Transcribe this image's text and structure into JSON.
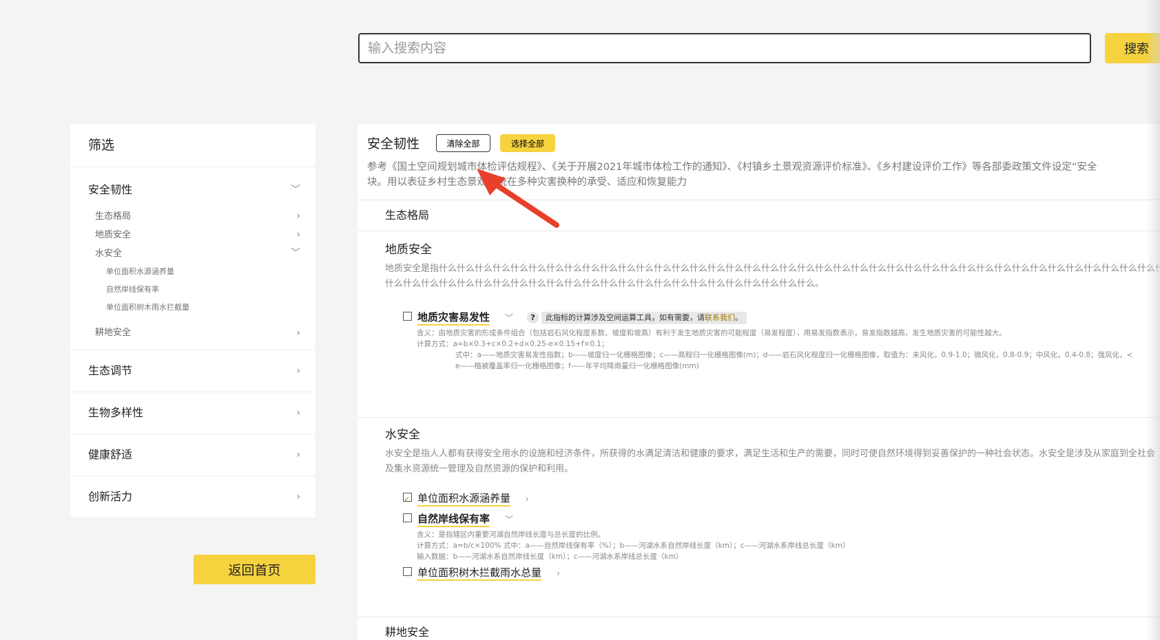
{
  "search": {
    "placeholder": "输入搜索内容",
    "button": "搜索"
  },
  "sidebar": {
    "title": "筛选",
    "groups": [
      {
        "label": "安全韧性",
        "expanded": true,
        "subs": [
          {
            "label": "生态格局"
          },
          {
            "label": "地质安全"
          },
          {
            "label": "水安全",
            "expanded": true,
            "children": [
              "单位面积水源涵养量",
              "自然岸线保有率",
              "单位面积树木雨水拦截量"
            ]
          },
          {
            "label": "耕地安全"
          }
        ]
      },
      {
        "label": "生态调节"
      },
      {
        "label": "生物多样性"
      },
      {
        "label": "健康舒适"
      },
      {
        "label": "创新活力"
      }
    ],
    "back_button": "返回首页"
  },
  "main": {
    "title": "安全韧性",
    "clear_all": "清除全部",
    "select_all": "选择全部",
    "desc_line1": "参考《国土空间规划城市体检评估规程》、《关于开展2021年城市体检工作的通知》、《村镇乡土景观资源评价标准》、《乡村建设评价工作》等各部委政策文件设定“安全",
    "desc_line2": "块。用以表征乡村生态景观系统在多种灾害换种的承受、适应和恢复能力",
    "eco": {
      "title": "生态格局"
    },
    "geo": {
      "title": "地质安全",
      "desc_line1": "地质安全是指什么什么什么什么什么什么什么什么什么什么什么什么什么什么什么什么什么什么什么什么什么什么什么什么什么什么什么什么什么什么什么什么什么什么什么什么什么什么什么什么什么",
      "desc_line2": "什么什么什么什么什么什么什么什么什么什么什么什么什么什么什么什么什么什么什么什么什么什么什么什么。",
      "indicator": {
        "name": "地质灾害易发性",
        "help": "?",
        "tip_prefix": "此指标的计算涉及空间运算工具，如有需要，请",
        "tip_link": "联系我们",
        "tip_suffix": "。",
        "d1": "含义：由地质灾害的形成条件组合（包括岩石风化程度系数、坡度和坡高）有利于发生地质灾害的可能程度（易发程度），用易发指数表示，易发指数越高，发生地质灾害的可能性越大。",
        "d2": "计算方式：a=b×0.3+c×0.2+d×0.25-e×0.15+f×0.1；",
        "d3": "式中：a——地质灾害易发性指数；b——坡度归一化栅格图像；c——高程归一化栅格图像(m)；d——岩石风化程度归一化栅格图像，取值为：未风化，0.9-1.0；微风化，0.8-0.9；中风化，0.4-0.8；强风化，<",
        "d4": "e——植被覆盖率归一化栅格图像；f——年平均降雨量归一化栅格图像(mm)"
      }
    },
    "water": {
      "title": "水安全",
      "desc_line1": "水安全是指人人都有获得安全用水的设施和经济条件，所获得的水满足清洁和健康的要求，满足生活和生产的需要，同时可使自然环境得到妥善保护的一种社会状态。水安全是涉及从家庭到全社会",
      "desc_line2": "及集水资源统一管理及自然资源的保护和利用。",
      "ind1": {
        "name": "单位面积水源涵养量",
        "checked": true
      },
      "ind2": {
        "name": "自然岸线保有率",
        "d1": "含义：是指辖区内重要河湖自然岸线长度与总长度的比例。",
        "d2": "计算方式：a=b/c×100% 式中：a——自然岸线保有率（%）；b——河湖水系自然岸线长度（km）；c——河湖水系岸线总长度（km）",
        "d3": "输入数据：b——河湖水系自然岸线长度（km）；c——河湖水系岸线总长度（km）"
      },
      "ind3": {
        "name": "单位面积树木拦截雨水总量"
      }
    },
    "farm": {
      "title": "耕地安全"
    }
  },
  "colors": {
    "accent": "#f7d23f",
    "annotation_arrow": "#e8402a"
  }
}
